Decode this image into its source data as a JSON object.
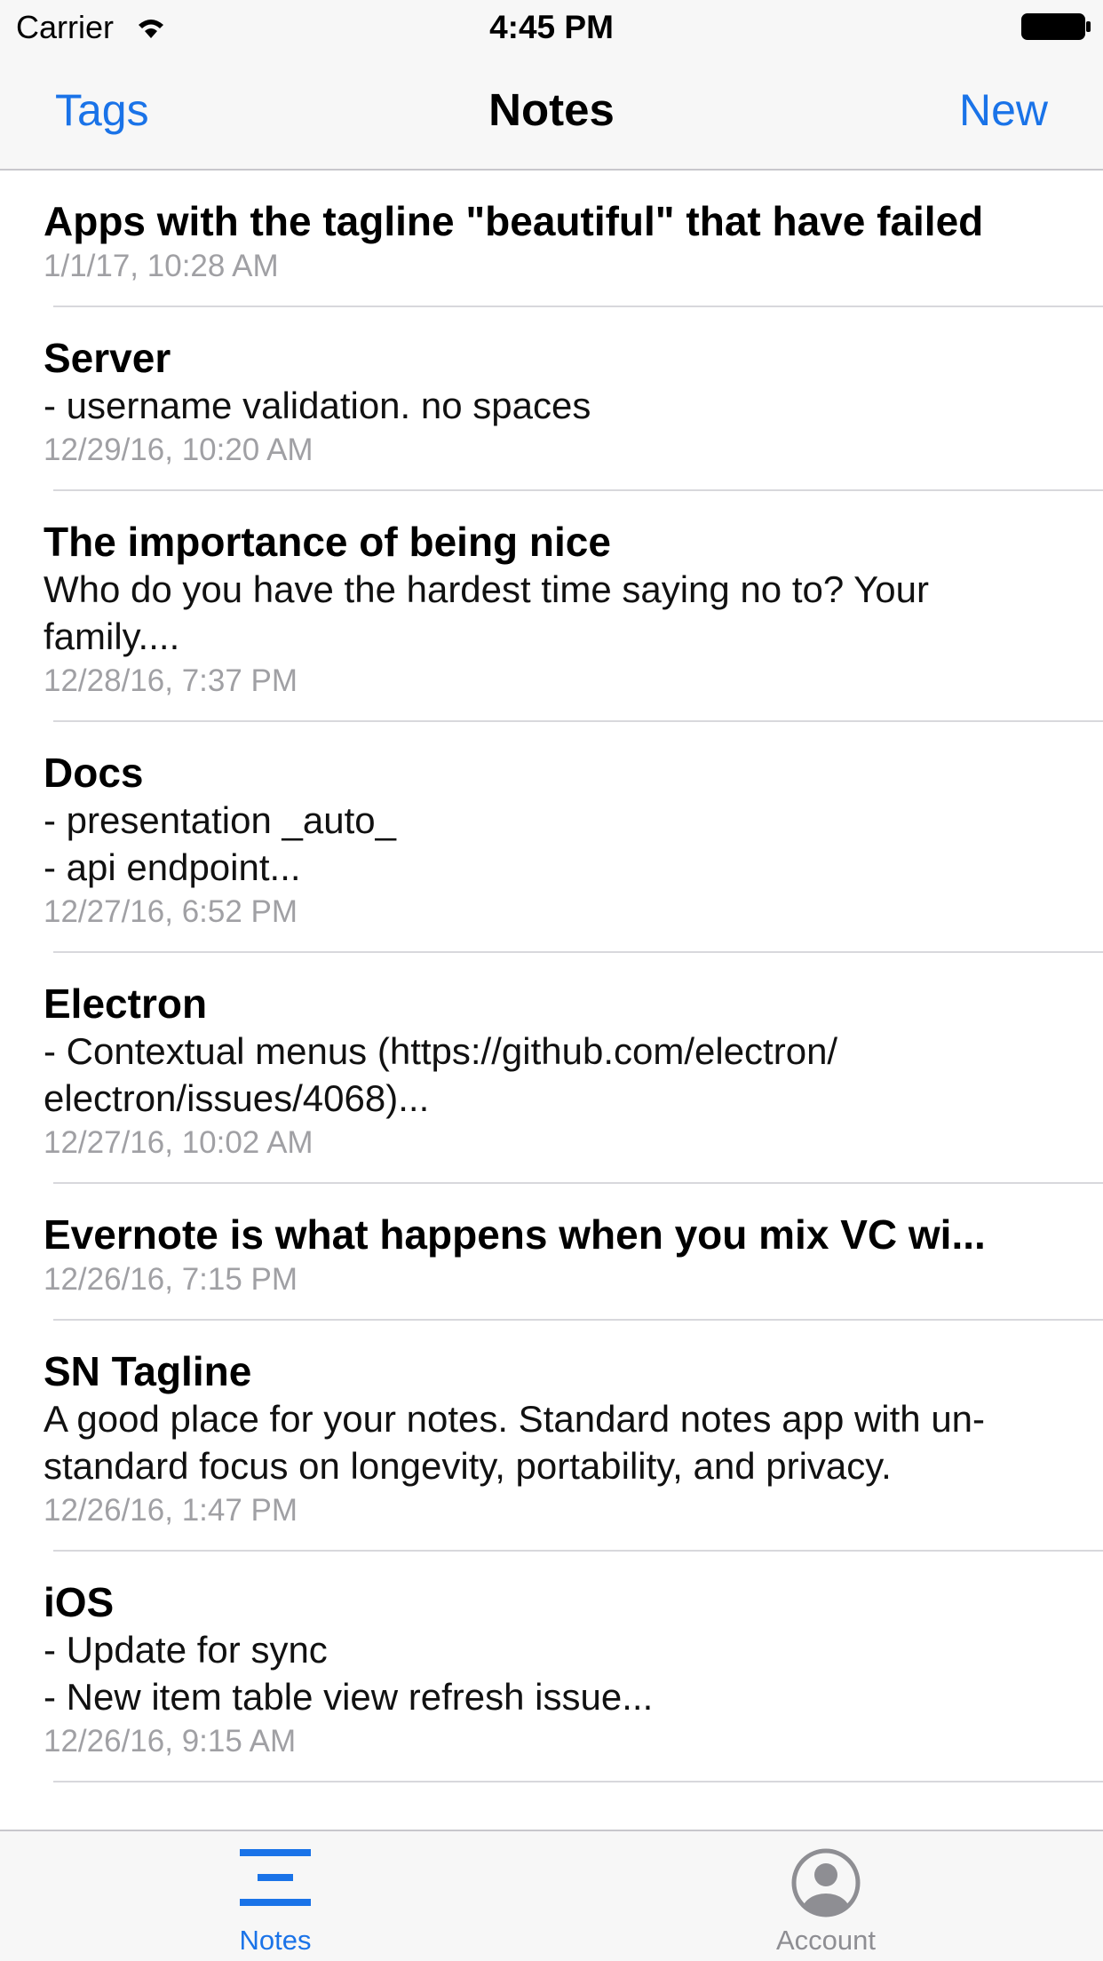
{
  "status_bar": {
    "carrier": "Carrier",
    "time": "4:45 PM"
  },
  "nav": {
    "left_label": "Tags",
    "title": "Notes",
    "right_label": "New"
  },
  "notes": [
    {
      "title": "Apps with the tagline \"beautiful\" that have failed",
      "preview": "",
      "date": "1/1/17, 10:28 AM"
    },
    {
      "title": "Server",
      "preview": "- username validation. no spaces",
      "date": "12/29/16, 10:20 AM"
    },
    {
      "title": "The importance of being nice",
      "preview": "Who do you have the hardest time saying no to? Your family....",
      "date": "12/28/16, 7:37 PM"
    },
    {
      "title": "Docs",
      "preview": "- presentation _auto_\n- api endpoint...",
      "date": "12/27/16, 6:52 PM"
    },
    {
      "title": "Electron",
      "preview": "- Contextual menus (https://github.com/electron/\nelectron/issues/4068)...",
      "date": "12/27/16, 10:02 AM"
    },
    {
      "title": "Evernote is what happens when you mix VC wi...",
      "preview": "",
      "date": "12/26/16, 7:15 PM"
    },
    {
      "title": "SN Tagline",
      "preview": "A good place for your notes. Standard notes app with un-standard focus on longevity, portability, and privacy.",
      "date": "12/26/16, 1:47 PM"
    },
    {
      "title": "iOS",
      "preview": "- Update for sync\n- New item table view refresh issue...",
      "date": "12/26/16, 9:15 AM"
    }
  ],
  "tab_bar": {
    "tabs": [
      {
        "label": "Notes",
        "icon": "list-icon",
        "selected": true
      },
      {
        "label": "Account",
        "icon": "account-icon",
        "selected": false
      }
    ]
  },
  "colors": {
    "accent": "#1a73e8",
    "date_gray": "#a0a0a4",
    "inactive_tab": "#8e8e93",
    "bar_background": "#f7f7f7"
  }
}
